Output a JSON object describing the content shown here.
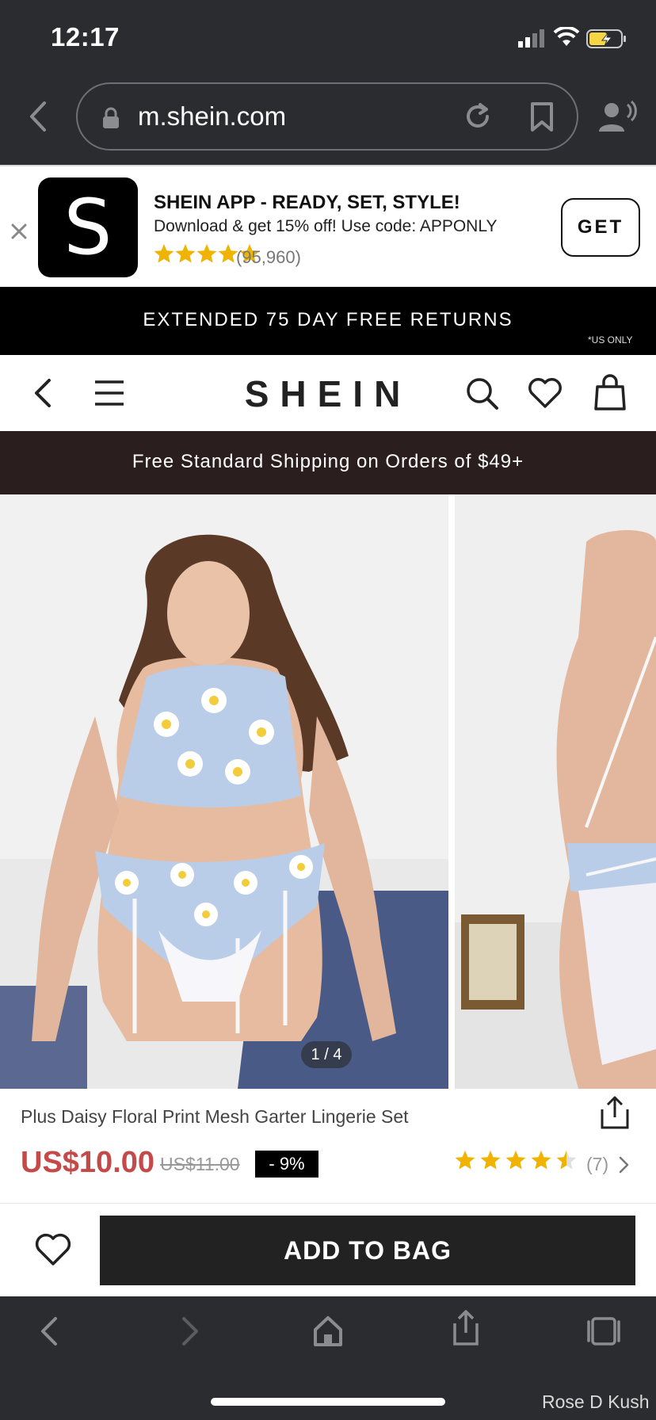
{
  "status_bar": {
    "time": "12:17"
  },
  "browser": {
    "url": "m.shein.com"
  },
  "app_banner": {
    "logo_letter": "S",
    "title": "SHEIN APP - READY, SET, STYLE!",
    "subtitle": "Download & get 15% off! Use code: APPONLY",
    "stars": 5,
    "rating_count": "(95,960)",
    "get_label": "GET"
  },
  "promo": {
    "text": "EXTENDED 75 DAY FREE RETURNS",
    "note": "*US ONLY"
  },
  "header": {
    "logo": "SHEIN"
  },
  "shipping": {
    "text": "Free Standard Shipping on Orders of $49+"
  },
  "gallery": {
    "counter": "1 / 4"
  },
  "product": {
    "title": "Plus Daisy Floral Print Mesh Garter Lingerie Set",
    "price": "US$10.00",
    "original_price": "US$11.00",
    "discount": "- 9%",
    "rating": 4.5,
    "review_count": "(7)"
  },
  "actions": {
    "add_to_bag": "ADD TO BAG"
  },
  "watermark": "Rose D Kush",
  "colors": {
    "price": "#c44a4a",
    "star": "#f0b400",
    "dark": "#222222",
    "chrome": "#2b2c30"
  }
}
